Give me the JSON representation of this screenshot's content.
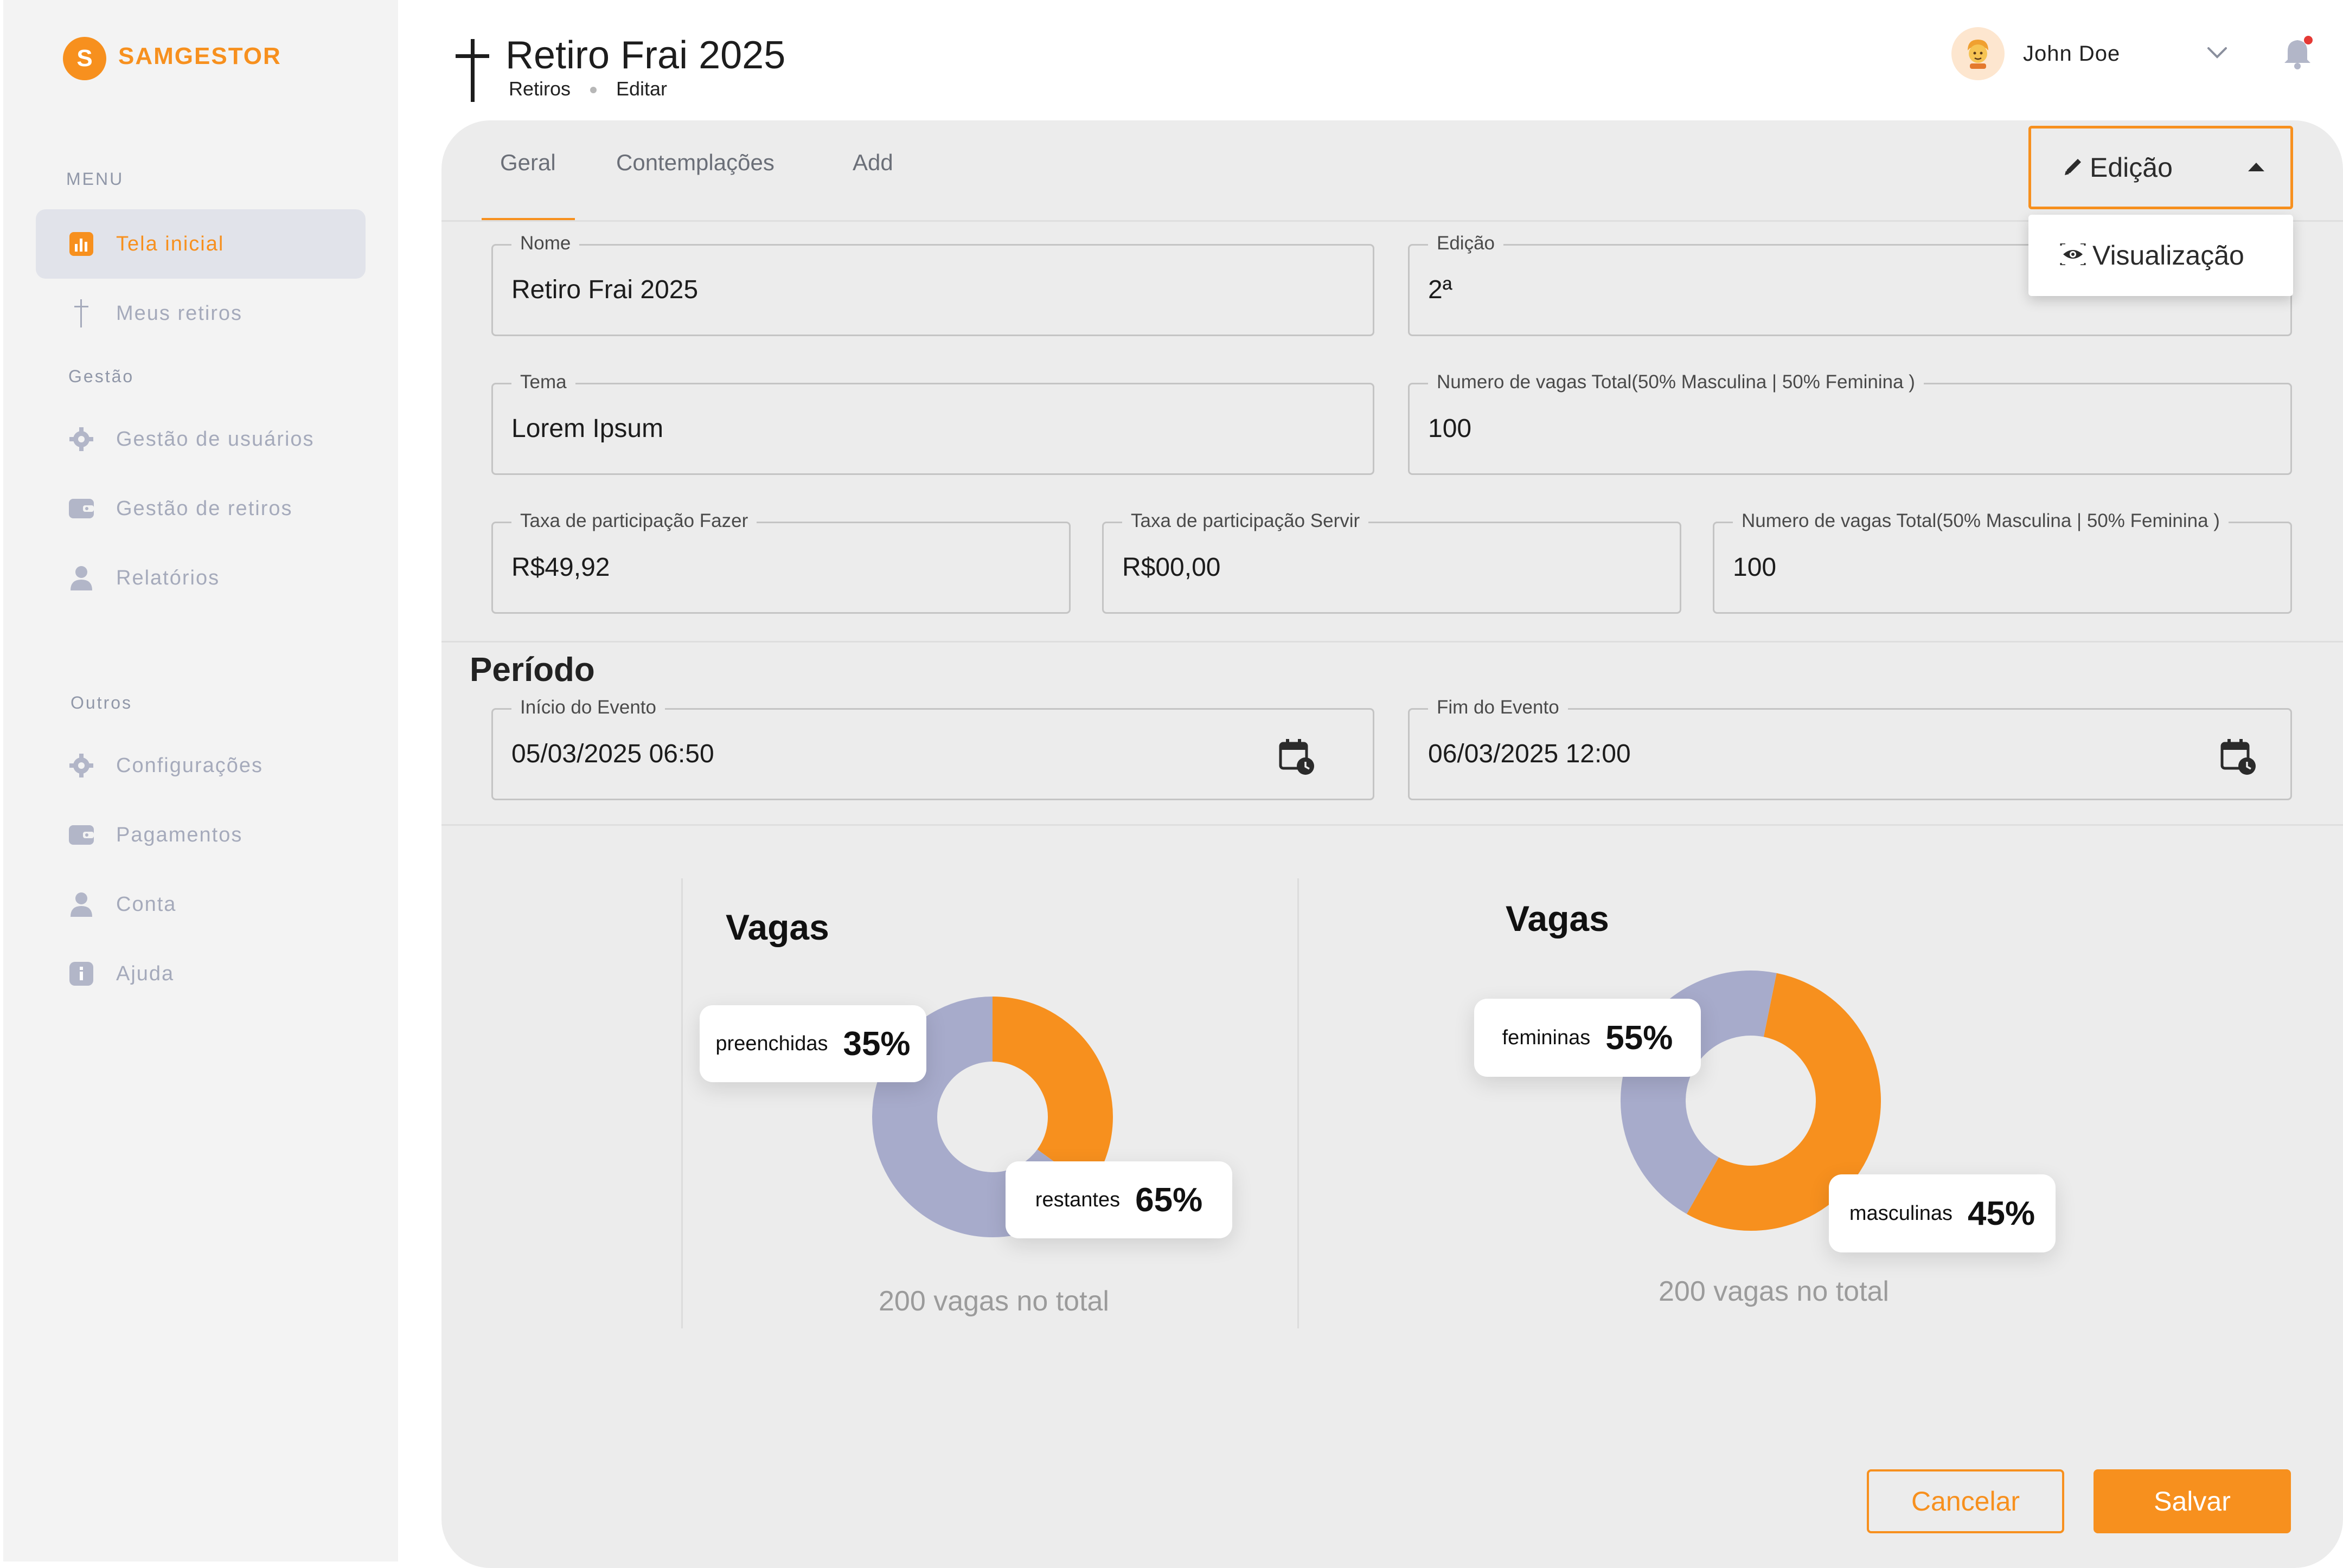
{
  "brand": {
    "letter": "S",
    "name": "SAMGESTOR"
  },
  "sidebar": {
    "sections": [
      "MENU",
      "Gestão",
      "Outros"
    ],
    "items": [
      {
        "label": "Tela inicial",
        "icon": "chart-icon",
        "active": true
      },
      {
        "label": "Meus retiros",
        "icon": "cross-icon"
      },
      {
        "label": "Gestão de usuários",
        "icon": "gear-icon"
      },
      {
        "label": "Gestão de retiros",
        "icon": "wallet-icon"
      },
      {
        "label": "Relatórios",
        "icon": "user-icon"
      },
      {
        "label": "Configurações",
        "icon": "gear-icon"
      },
      {
        "label": "Pagamentos",
        "icon": "wallet-icon"
      },
      {
        "label": "Conta",
        "icon": "user-icon"
      },
      {
        "label": "Ajuda",
        "icon": "info-icon"
      }
    ]
  },
  "header": {
    "title": "Retiro Frai 2025",
    "breadcrumb": [
      "Retiros",
      "Editar"
    ],
    "user_name": "John Doe"
  },
  "tabs": [
    "Geral",
    "Contemplações",
    "Add"
  ],
  "mode": {
    "selected": "Edição",
    "option": "Visualização"
  },
  "form": {
    "nome": {
      "label": "Nome",
      "value": "Retiro Frai 2025"
    },
    "edicao": {
      "label": "Edição",
      "value": "2ª"
    },
    "tema": {
      "label": "Tema",
      "value": "Lorem Ipsum"
    },
    "vagas_total": {
      "label": "Numero de vagas Total(50% Masculina | 50% Feminina )",
      "value": "100"
    },
    "taxa_fazer": {
      "label": "Taxa de participação Fazer",
      "value": "R$49,92"
    },
    "taxa_servir": {
      "label": "Taxa de participação Servir",
      "value": "R$00,00"
    },
    "vagas_total_2": {
      "label": "Numero de vagas Total(50% Masculina | 50% Feminina )",
      "value": "100"
    }
  },
  "periodo": {
    "title": "Período",
    "inicio": {
      "label": "Início do Evento",
      "value": "05/03/2025 06:50"
    },
    "fim": {
      "label": "Fim do Evento",
      "value": "06/03/2025 12:00"
    }
  },
  "charts": [
    {
      "title": "Vagas",
      "total": "200 vagas no total",
      "slices": [
        {
          "label": "preenchidas",
          "pct": "35%",
          "value": 35,
          "color": "#f7901e"
        },
        {
          "label": "restantes",
          "pct": "65%",
          "value": 65,
          "color": "#a7abcb"
        }
      ]
    },
    {
      "title": "Vagas",
      "total": "200 vagas no total",
      "slices": [
        {
          "label": "femininas",
          "pct": "55%",
          "value": 55,
          "color": "#f7901e"
        },
        {
          "label": "masculinas",
          "pct": "45%",
          "value": 45,
          "color": "#a7abcb"
        }
      ]
    }
  ],
  "chart_data": [
    {
      "type": "pie",
      "title": "Vagas",
      "categories": [
        "preenchidas",
        "restantes"
      ],
      "values": [
        35,
        65
      ]
    },
    {
      "type": "pie",
      "title": "Vagas",
      "categories": [
        "femininas",
        "masculinas"
      ],
      "values": [
        55,
        45
      ]
    }
  ],
  "actions": {
    "cancel": "Cancelar",
    "save": "Salvar"
  },
  "colors": {
    "accent": "#f7901e",
    "secondary": "#a7abcb",
    "panel": "#ececec",
    "sidebar": "#f3f3f3",
    "notification": "#e53935"
  }
}
